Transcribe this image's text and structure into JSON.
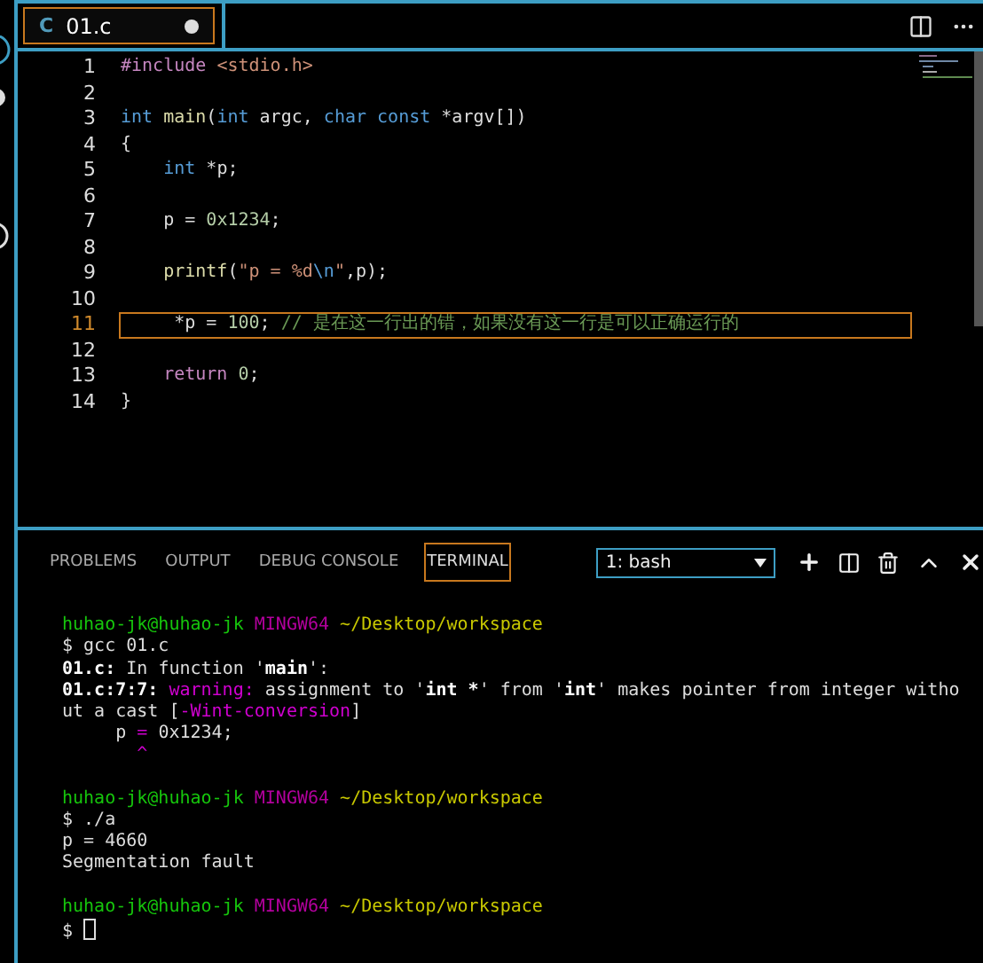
{
  "editor": {
    "tab": {
      "icon": "C",
      "label": "01.c",
      "modified": true,
      "selected": true
    },
    "lines": [
      {
        "number": "1",
        "selected": false,
        "segments": [
          {
            "text": "#include",
            "kind": "directive"
          },
          {
            "text": " <stdio.h>",
            "kind": "string"
          }
        ]
      },
      {
        "number": "2",
        "selected": false
      },
      {
        "number": "3",
        "selected": false,
        "segments": [
          {
            "text": "int",
            "kind": "keyword"
          },
          {
            "text": " main",
            "kind": "function"
          },
          {
            "text": "(",
            "kind": "plain"
          },
          {
            "text": "int",
            "kind": "keyword"
          },
          {
            "text": " argc, ",
            "kind": "plain"
          },
          {
            "text": "char",
            "kind": "keyword"
          },
          {
            "text": " const",
            "kind": "keyword"
          },
          {
            "text": " *argv[])",
            "kind": "plain"
          }
        ]
      },
      {
        "number": "4",
        "selected": false,
        "segments": [
          {
            "text": "{",
            "kind": "plain"
          }
        ]
      },
      {
        "number": "5",
        "selected": false,
        "segments": [
          {
            "text": "    int",
            "kind": "keyword"
          },
          {
            "text": " *p;",
            "kind": "plain"
          }
        ]
      },
      {
        "number": "6",
        "selected": false
      },
      {
        "number": "7",
        "selected": false,
        "segments": [
          {
            "text": "    p = ",
            "kind": "plain"
          },
          {
            "text": "0x1234",
            "kind": "number"
          },
          {
            "text": ";",
            "kind": "plain"
          }
        ]
      },
      {
        "number": "8",
        "selected": false
      },
      {
        "number": "9",
        "selected": false,
        "segments": [
          {
            "text": "    printf",
            "kind": "function"
          },
          {
            "text": "(",
            "kind": "plain"
          },
          {
            "text": "\"p = %d",
            "kind": "string"
          },
          {
            "text": "\\n",
            "kind": "escape"
          },
          {
            "text": "\"",
            "kind": "string"
          },
          {
            "text": ",p);",
            "kind": "plain"
          }
        ]
      },
      {
        "number": "10",
        "selected": false
      },
      {
        "number": "11",
        "selected": true,
        "segments": [
          {
            "text": "     *p = ",
            "kind": "plain"
          },
          {
            "text": "100",
            "kind": "number"
          },
          {
            "text": ";",
            "kind": "plain"
          },
          {
            "text": " // 是在这一行出的错，如果没有这一行是可以正确运行的",
            "kind": "comment"
          }
        ]
      },
      {
        "number": "12",
        "selected": false
      },
      {
        "number": "13",
        "selected": false,
        "segments": [
          {
            "text": "    return",
            "kind": "control"
          },
          {
            "text": " 0",
            "kind": "number"
          },
          {
            "text": ";",
            "kind": "plain"
          }
        ]
      },
      {
        "number": "14",
        "selected": false,
        "segments": [
          {
            "text": "}",
            "kind": "plain"
          }
        ]
      }
    ]
  },
  "panel": {
    "tabs": [
      {
        "label": "PROBLEMS",
        "selected": false
      },
      {
        "label": "OUTPUT",
        "selected": false
      },
      {
        "label": "DEBUG CONSOLE",
        "selected": false
      },
      {
        "label": "TERMINAL",
        "selected": true
      }
    ],
    "terminal_select": "1: bash",
    "terminal": {
      "cursor_visible": true,
      "lines": [
        {
          "kind": "blank"
        },
        {
          "kind": "output",
          "segments": [
            {
              "text": "huhao-jk@huhao-jk",
              "kind": "user"
            },
            {
              "text": " MINGW64",
              "kind": "host"
            },
            {
              "text": " ~/Desktop/workspace",
              "kind": "path"
            }
          ]
        },
        {
          "kind": "output",
          "segments": [
            {
              "text": "$ gcc 01.c",
              "kind": "plain"
            }
          ]
        },
        {
          "kind": "output",
          "segments": [
            {
              "text": "01.c:",
              "kind": "bold"
            },
            {
              "text": " In function '",
              "kind": "plain"
            },
            {
              "text": "main",
              "kind": "bold"
            },
            {
              "text": "':",
              "kind": "plain"
            }
          ]
        },
        {
          "kind": "output",
          "segments": [
            {
              "text": "01.c:7:7:",
              "kind": "bold"
            },
            {
              "text": " warning:",
              "kind": "warning"
            },
            {
              "text": " assignment to '",
              "kind": "plain"
            },
            {
              "text": "int *",
              "kind": "bold"
            },
            {
              "text": "' from '",
              "kind": "plain"
            },
            {
              "text": "int",
              "kind": "bold"
            },
            {
              "text": "' makes pointer from integer witho",
              "kind": "plain"
            }
          ]
        },
        {
          "kind": "output",
          "segments": [
            {
              "text": "ut a cast [",
              "kind": "plain"
            },
            {
              "text": "-Wint-conversion",
              "kind": "warning"
            },
            {
              "text": "]",
              "kind": "plain"
            }
          ]
        },
        {
          "kind": "output",
          "segments": [
            {
              "text": "     p ",
              "kind": "plain"
            },
            {
              "text": "=",
              "kind": "warning"
            },
            {
              "text": " 0x1234;",
              "kind": "plain"
            }
          ]
        },
        {
          "kind": "output",
          "segments": [
            {
              "text": "       ^",
              "kind": "warning"
            }
          ]
        },
        {
          "kind": "blank"
        },
        {
          "kind": "output",
          "segments": [
            {
              "text": "huhao-jk@huhao-jk",
              "kind": "user"
            },
            {
              "text": " MINGW64",
              "kind": "host"
            },
            {
              "text": " ~/Desktop/workspace",
              "kind": "path"
            }
          ]
        },
        {
          "kind": "output",
          "segments": [
            {
              "text": "$ ./a",
              "kind": "plain"
            }
          ]
        },
        {
          "kind": "output",
          "segments": [
            {
              "text": "p = 4660",
              "kind": "plain"
            }
          ]
        },
        {
          "kind": "output",
          "segments": [
            {
              "text": "Segmentation fault",
              "kind": "plain"
            }
          ]
        },
        {
          "kind": "blank"
        },
        {
          "kind": "output",
          "segments": [
            {
              "text": "huhao-jk@huhao-jk",
              "kind": "user"
            },
            {
              "text": " MINGW64",
              "kind": "host"
            },
            {
              "text": " ~/Desktop/workspace",
              "kind": "path"
            }
          ]
        },
        {
          "kind": "output",
          "segments": [
            {
              "text": "$",
              "kind": "plain"
            }
          ]
        }
      ]
    }
  }
}
